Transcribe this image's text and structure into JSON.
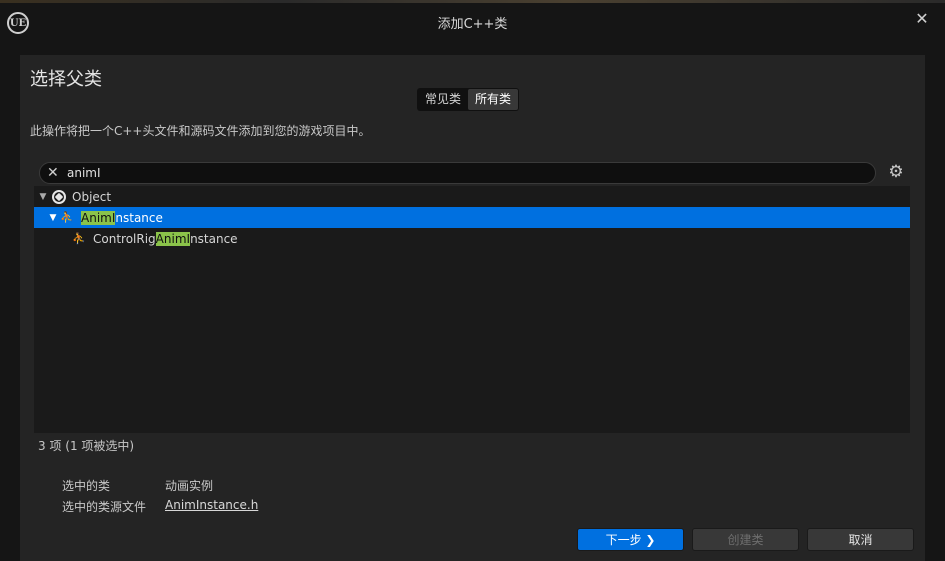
{
  "window": {
    "title": "添加C++类",
    "logo": "UE",
    "close_glyph": "✕"
  },
  "heading": "选择父类",
  "tabs": [
    {
      "label": "常见类",
      "active": false
    },
    {
      "label": "所有类",
      "active": true
    }
  ],
  "description": "此操作将把一个C++头文件和源码文件添加到您的游戏项目中。",
  "search": {
    "value": "animI",
    "clear_glyph": "✕"
  },
  "settings_glyph": "⚙",
  "tree": {
    "rows": [
      {
        "pre": "",
        "match": "",
        "post": "Object",
        "icon": "object-icon",
        "expanded": true
      },
      {
        "pre": "",
        "match": "AnimI",
        "post": "nstance",
        "icon": "anim-instance-icon",
        "expanded": true,
        "selected": true
      },
      {
        "pre": "ControlRig",
        "match": "AnimI",
        "post": "nstance",
        "icon": "anim-instance-icon"
      }
    ]
  },
  "status": "3 项 (1 项被选中)",
  "details": {
    "selected_class_label": "选中的类",
    "selected_class_value": "动画实例",
    "source_file_label": "选中的类源文件",
    "source_file_value": "AnimInstance.h"
  },
  "buttons": {
    "next": "下一步 ❯",
    "create": "创建类",
    "cancel": "取消"
  },
  "colors": {
    "accent": "#0070e0",
    "highlight": "#8bc34a"
  }
}
